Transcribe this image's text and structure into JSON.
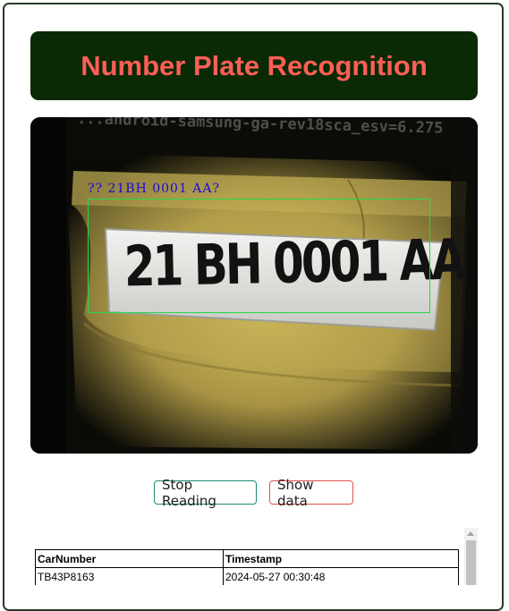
{
  "header": {
    "title": "Number Plate Recognition"
  },
  "camera": {
    "overlay_text": "?? 21BH 0001 AA?",
    "plate_text": "21 BH 0001 AA",
    "watermark_text": "...android-samsung-ga-rev18sca_esv=6.275"
  },
  "buttons": {
    "stop_label": "Stop Reading",
    "show_label": "Show data"
  },
  "table": {
    "headers": [
      "CarNumber",
      "Timestamp"
    ],
    "rows": [
      [
        "TB43P8163",
        "2024-05-27 00:30:48"
      ]
    ]
  },
  "colors": {
    "header_bg": "#0a2a05",
    "title_color": "#ff5e57",
    "stop_border": "#1f8a74",
    "show_border": "#e4514b",
    "detect_box": "#27d84a",
    "overlay_text": "#1a0ad8"
  }
}
